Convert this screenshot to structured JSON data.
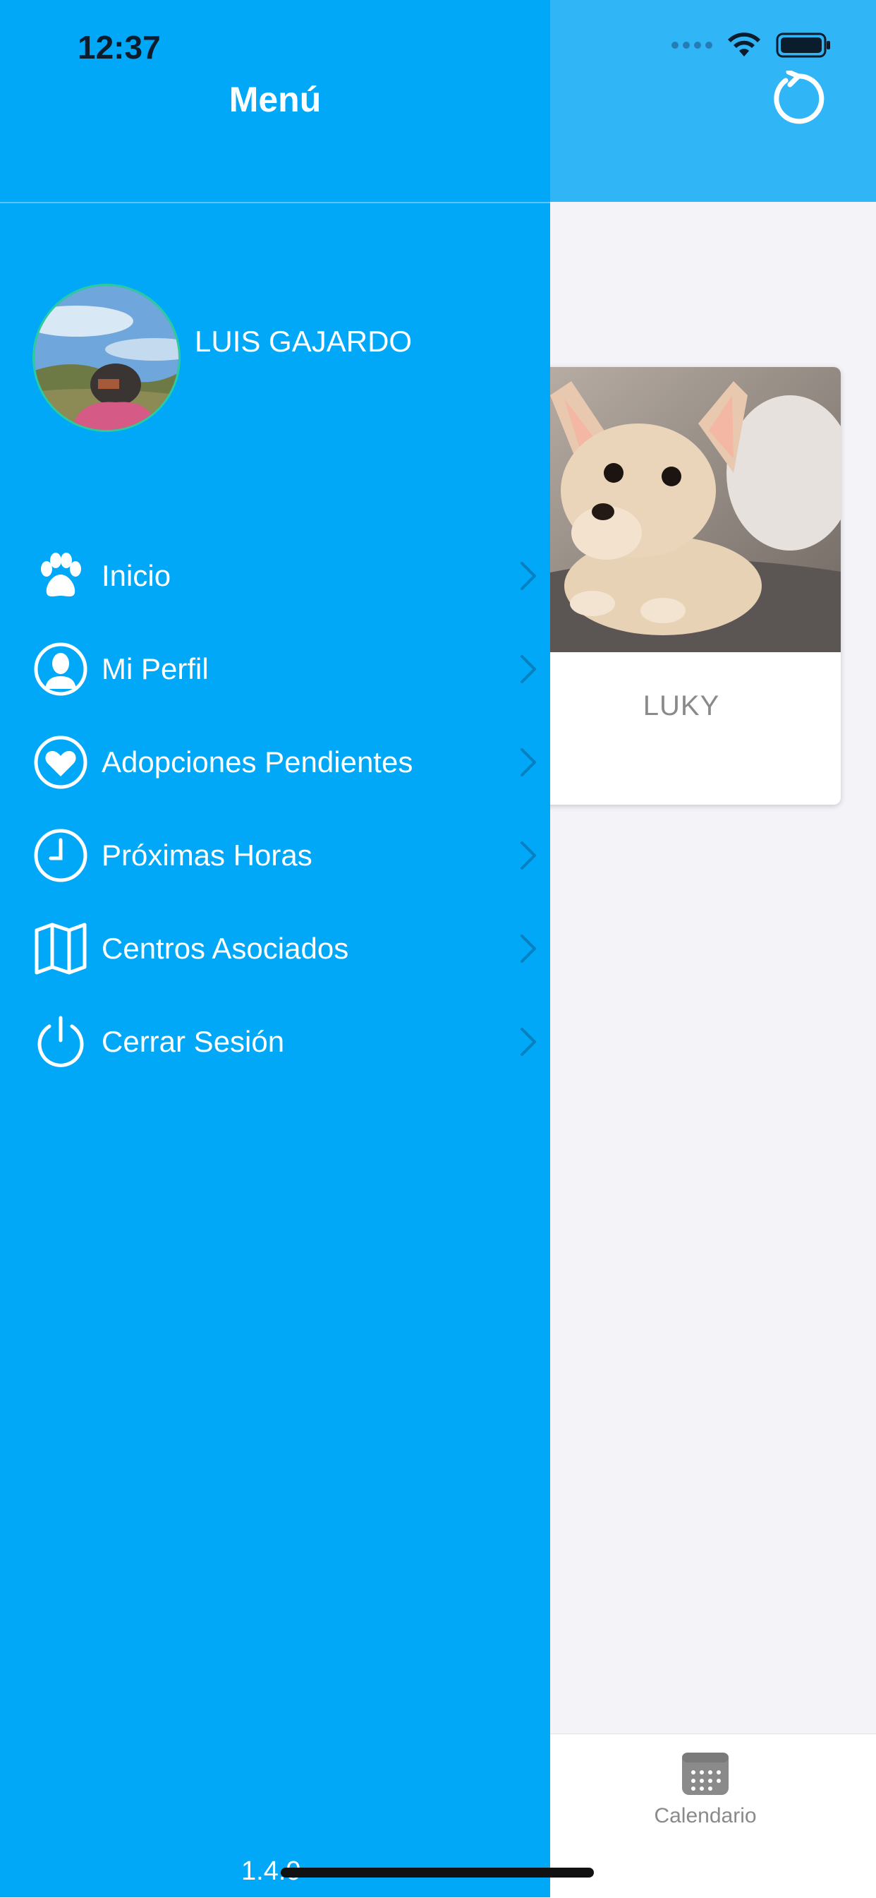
{
  "status_bar": {
    "time": "12:37"
  },
  "drawer": {
    "title": "Menú",
    "user": {
      "name": "LUIS GAJARDO"
    },
    "menu": [
      {
        "label": "Inicio",
        "icon": "paw-icon"
      },
      {
        "label": "Mi Perfil",
        "icon": "person-icon"
      },
      {
        "label": "Adopciones Pendientes",
        "icon": "heart-icon"
      },
      {
        "label": "Próximas Horas",
        "icon": "clock-icon"
      },
      {
        "label": "Centros Asociados",
        "icon": "map-icon"
      },
      {
        "label": "Cerrar Sesión",
        "icon": "power-icon"
      }
    ],
    "version": "1.4.0"
  },
  "content": {
    "pet_card": {
      "name": "LUKY"
    },
    "tabbar": {
      "calendar_label": "Calendario"
    }
  },
  "colors": {
    "drawer_bg": "#00A8F7",
    "header_bg": "#30B6F7",
    "content_bg": "#F3F3F8"
  }
}
